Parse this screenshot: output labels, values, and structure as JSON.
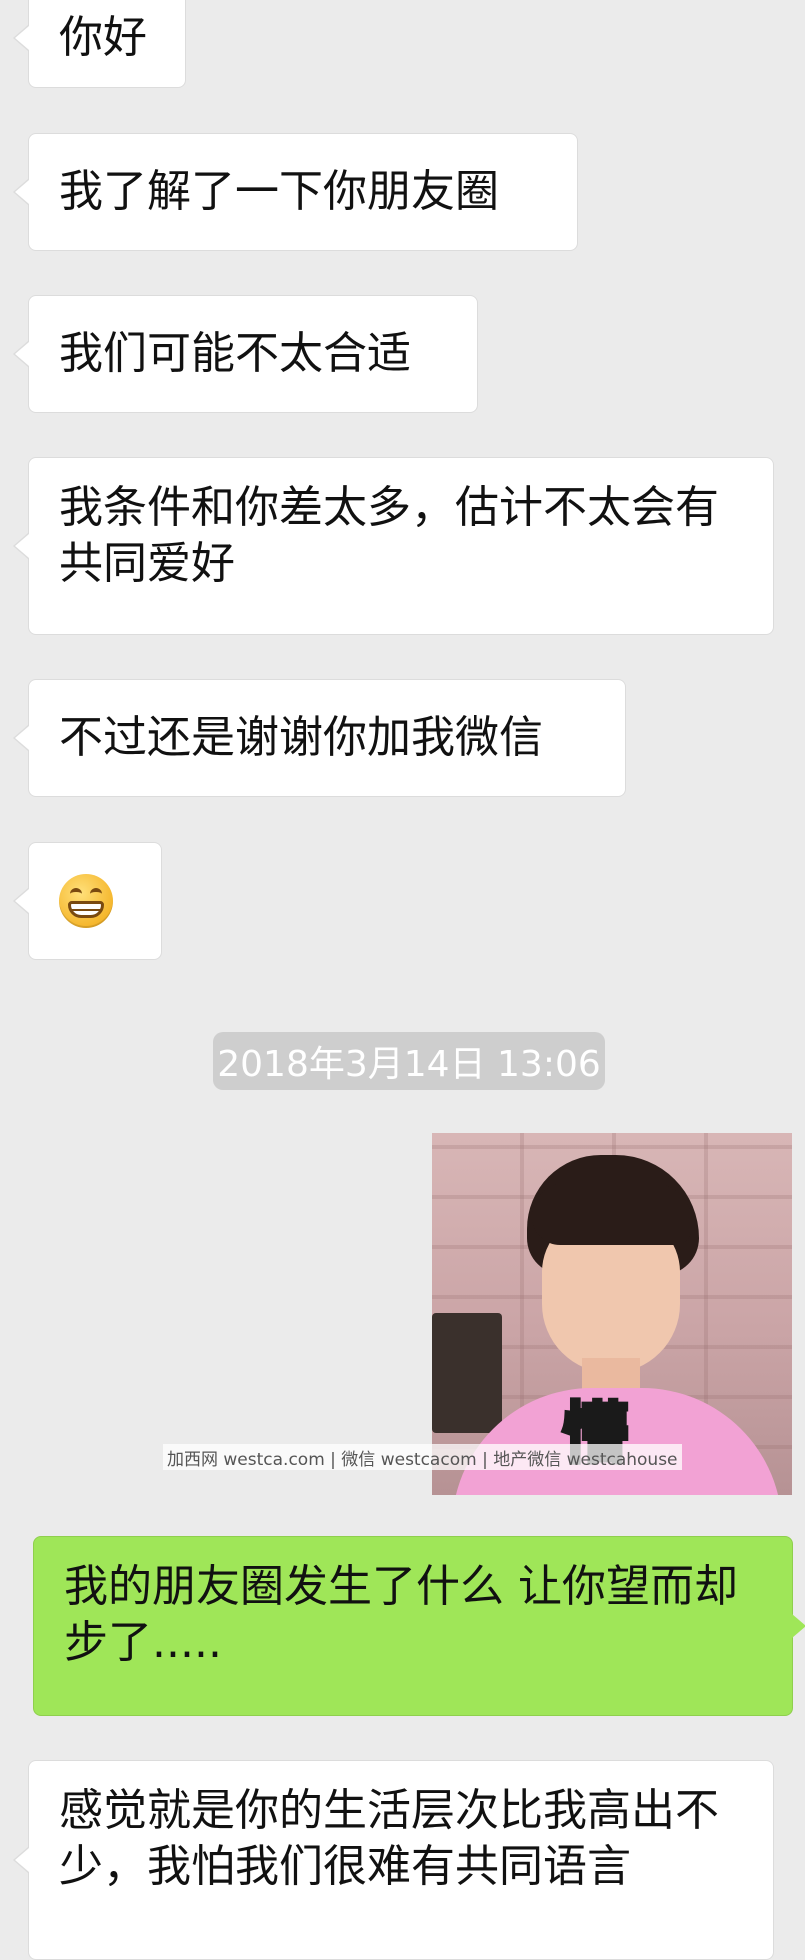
{
  "messages": [
    {
      "text": "你好"
    },
    {
      "text": "我了解了一下你朋友圈"
    },
    {
      "text": "我们可能不太合适"
    },
    {
      "text": "我条件和你差太多，估计不太会有共同爱好"
    },
    {
      "text": "不过还是谢谢你加我微信"
    },
    {
      "emoji": "grinning-emoji-icon"
    },
    {
      "timestamp": "2018年3月14日 13:06"
    },
    {
      "sticker_caption": "懵"
    },
    {
      "text": "我的朋友圈发生了什么 让你望而却步了....."
    },
    {
      "text": "感觉就是你的生活层次比我高出不少，我怕我们很难有共同语言"
    }
  ],
  "watermark": "加西网 westca.com | 微信 westcacom | 地产微信 westcahouse",
  "colors": {
    "background": "#ebebeb",
    "incoming_bubble": "#ffffff",
    "outgoing_bubble": "#9fe658",
    "timestamp_bg": "#cecece"
  }
}
